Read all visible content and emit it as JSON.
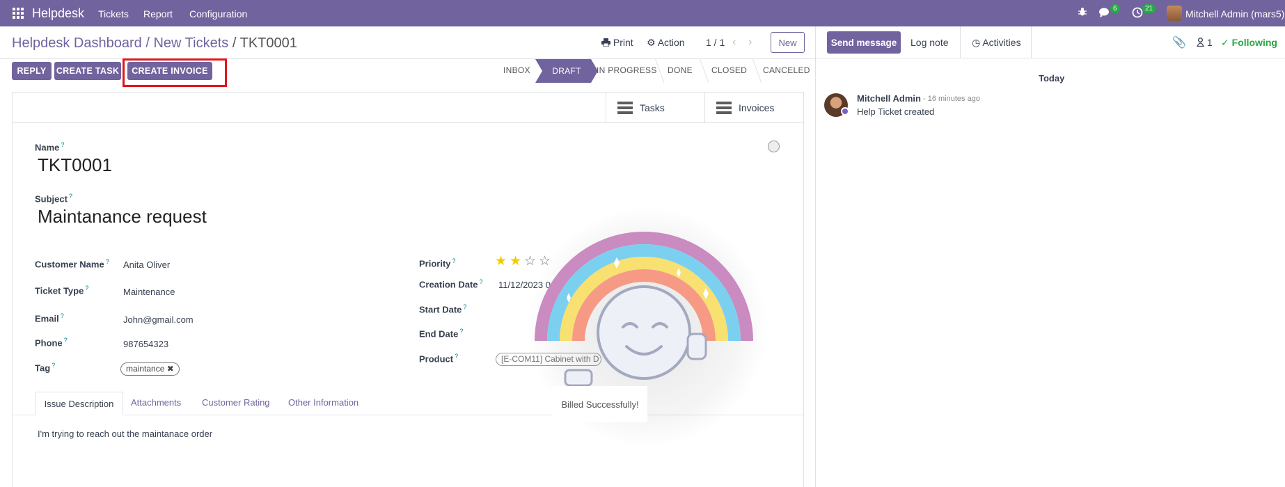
{
  "topbar": {
    "brand": "Helpdesk",
    "menus": [
      "Tickets",
      "Report",
      "Configuration"
    ],
    "chat_count": "6",
    "activity_count": "21",
    "user": "Mitchell Admin (mars5)"
  },
  "breadcrumb": {
    "part1": "Helpdesk Dashboard",
    "sep1": "/",
    "part2": "New Tickets",
    "sep2": "/",
    "current": "TKT0001"
  },
  "controls": {
    "print": "Print",
    "action": "Action",
    "pager": "1 / 1",
    "new": "New"
  },
  "buttons": {
    "reply": "REPLY",
    "create_task": "CREATE TASK",
    "create_invoice": "CREATE INVOICE"
  },
  "stages": {
    "inbox": "INBOX",
    "draft": "DRAFT",
    "in_progress": "IN PROGRESS",
    "done": "DONE",
    "closed": "CLOSED",
    "canceled": "CANCELED",
    "active": "DRAFT"
  },
  "smart_buttons": {
    "tasks": "Tasks",
    "invoices": "Invoices"
  },
  "form": {
    "name_label": "Name",
    "name_value": "TKT0001",
    "subject_label": "Subject",
    "subject_value": "Maintanance request",
    "customer_label": "Customer Name",
    "customer_value": "Anita Oliver",
    "ticket_type_label": "Ticket Type",
    "ticket_type_value": "Maintenance",
    "email_label": "Email",
    "email_value": "John@gmail.com",
    "phone_label": "Phone",
    "phone_value": "987654323",
    "tag_label": "Tag",
    "tag_value": "maintance",
    "priority_label": "Priority",
    "priority_stars": 2,
    "priority_max": 4,
    "creation_label": "Creation Date",
    "creation_value": "11/12/2023 0",
    "start_label": "Start Date",
    "end_label": "End Date",
    "product_label": "Product",
    "product_value": "[E-COM11] Cabinet with D"
  },
  "tabs": {
    "issue": "Issue Description",
    "attachments": "Attachments",
    "rating": "Customer Rating",
    "other": "Other Information"
  },
  "description": "I'm trying to  reach out the maintanace order",
  "toast": "Billed Successfully!",
  "chatter": {
    "send_message": "Send message",
    "log_note": "Log note",
    "activities": "Activities",
    "follower_count": "1",
    "following": "Following",
    "today": "Today",
    "author": "Mitchell Admin",
    "time": "- 16 minutes ago",
    "message": "Help Ticket created"
  },
  "colors": {
    "brand": "#71639e",
    "following": "#28a745",
    "highlight": "#e0161b"
  }
}
